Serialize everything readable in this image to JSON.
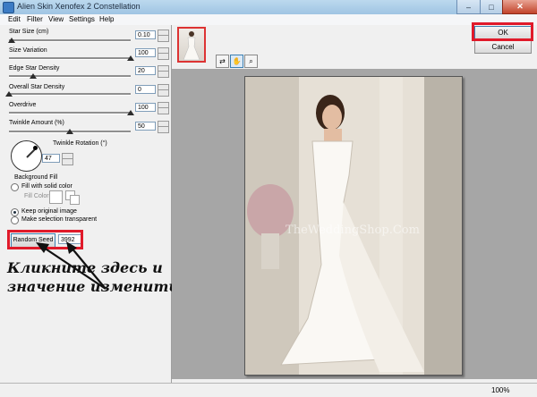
{
  "window": {
    "title": "Alien Skin Xenofex 2 Constellation"
  },
  "title_buttons": {
    "minimize": "–",
    "maximize": "□",
    "close": "✕"
  },
  "menu": [
    "Edit",
    "Filter",
    "View",
    "Settings",
    "Help"
  ],
  "params": [
    {
      "label": "Star Size (cm)",
      "value": "0.10",
      "level": 0.02
    },
    {
      "label": "Size Variation",
      "value": "100",
      "level": 1.0
    },
    {
      "label": "Edge Star Density",
      "value": "20",
      "level": 0.2
    },
    {
      "label": "Overall Star Density",
      "value": "0",
      "level": 0.0
    },
    {
      "label": "Overdrive",
      "value": "100",
      "level": 1.0
    },
    {
      "label": "Twinkle Amount (%)",
      "value": "50",
      "level": 0.5
    }
  ],
  "twinkle_rotation": {
    "label": "Twinkle Rotation (°)",
    "value": "47"
  },
  "background_fill": {
    "heading": "Background Fill",
    "fill_solid": "Fill with solid color",
    "fill_color": "Fill Color",
    "keep_original": "Keep original image",
    "make_transparent": "Make selection transparent",
    "selected": "keep_original"
  },
  "seed": {
    "button": "Random Seed",
    "value": "3992"
  },
  "annotation": {
    "line1": "Кликните здесь и",
    "line2": "значение измениться"
  },
  "buttons": {
    "ok": "OK",
    "cancel": "Cancel"
  },
  "preview": {
    "watermark": "TheWeddingShop.Com"
  },
  "status": {
    "zoom": "100%"
  },
  "colors": {
    "highlight": "#e01a2a",
    "preview_bg": "#a6a6a6"
  }
}
